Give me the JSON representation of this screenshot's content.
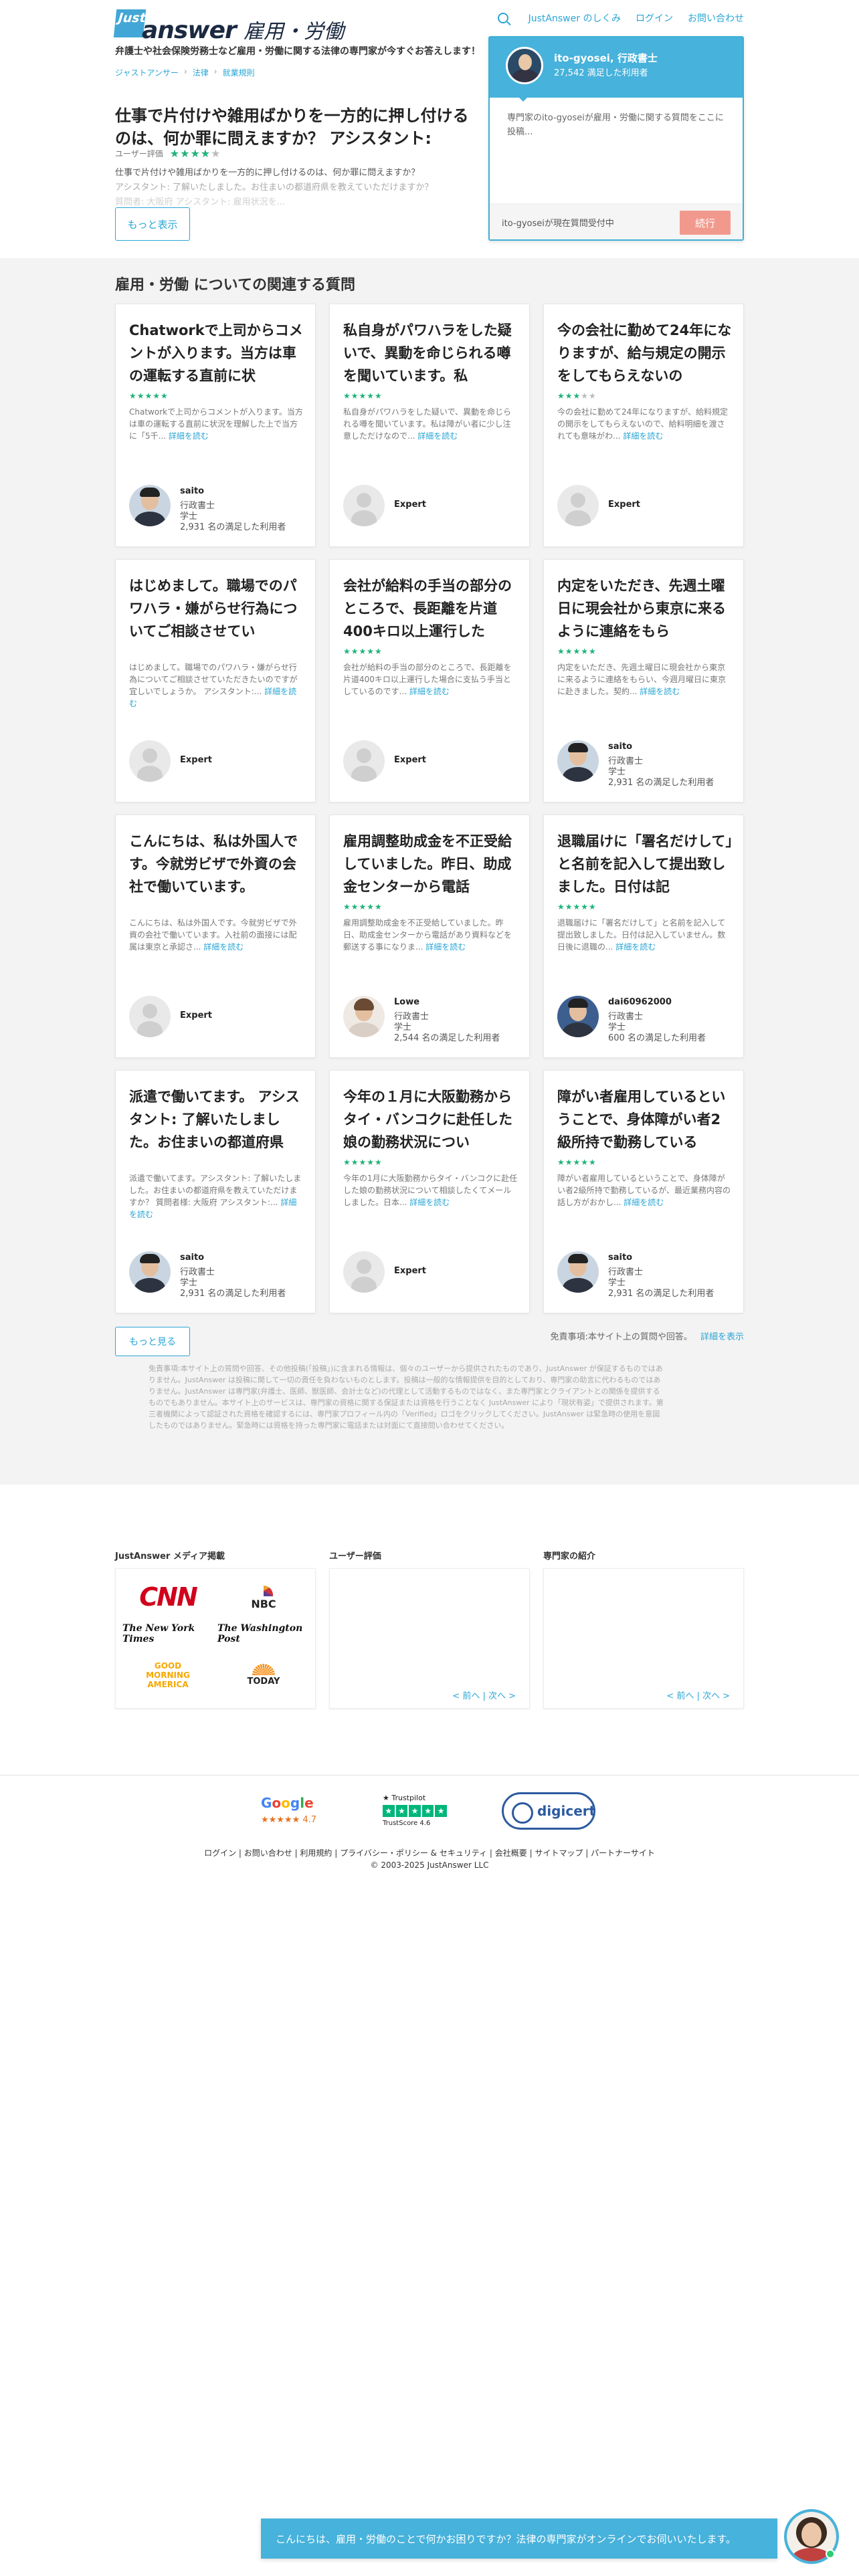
{
  "header": {
    "logo_just": "Just",
    "logo_answer": "answer",
    "logo_category": "雇用・労働",
    "tagline": "弁護士や社会保険労務士など雇用・労働に関する法律の専門家が今すぐお答えします！",
    "nav": [
      "JustAnswer のしくみ",
      "ログイン",
      "お問い合わせ"
    ]
  },
  "breadcrumb": [
    "ジャストアンサー",
    "法律",
    "就業規則"
  ],
  "question": {
    "title": "仕事で片付けや雑用ばかりを一方的に押し付けるのは、何か罪に問えますか？ アシスタント:",
    "rating_label": "ユーザー評価",
    "stars": "★★★★",
    "stars_off": "★",
    "body_line1": "仕事で片付けや雑用ばかりを一方的に押し付けるのは、何か罪に問えますか？",
    "body_line2": "アシスタント: 了解いたしました。お住まいの都道府県を教えていただけますか？",
    "body_line3": "質問者: 大阪府 アシスタント: 雇用状況を...",
    "more_button": "もっと表示"
  },
  "chat_widget": {
    "expert_name": "ito-gyosei, 行政書士",
    "expert_sub": "27,542 満足した利用者",
    "message": "専門家のito-gyoseiが雇用・労働に関する質問をここに投稿...",
    "status": "ito-gyoseiが現在質問受付中",
    "button": "続行"
  },
  "related": {
    "title": "雇用・労働 についての関連する質問",
    "read_more": "詳細を読む",
    "cards": [
      {
        "title": "Chatworkで上司からコメントが入ります。当方は車の運転する直前に状",
        "stars": "★★★★★",
        "stars_off": "",
        "snippet": "Chatworkで上司からコメントが入ります。当方は車の運転する直前に状況を理解した上で当方に「5千...",
        "expert": {
          "name": "saito",
          "line1": "行政書士",
          "line2": "学士",
          "line3": "2,931 名の満足した利用者"
        },
        "avatar": "photo"
      },
      {
        "title": "私自身がパワハラをした疑いで、異動を命じられる噂を聞いています。私",
        "stars": "★★★★★",
        "stars_off": "",
        "snippet": "私自身がパワハラをした疑いで、異動を命じられる噂を聞いています。私は障がい者に少し注意しただけなので...",
        "expert": {
          "name": "Expert"
        },
        "avatar": "generic"
      },
      {
        "title": "今の会社に勤めて24年になりますが、給与規定の開示をしてもらえないの",
        "stars": "★★★",
        "stars_off": "★★",
        "snippet": "今の会社に勤めて24年になりますが、給料規定の開示をしてもらえないので、給料明細を渡されても意味がわ...",
        "expert": {
          "name": "Expert"
        },
        "avatar": "generic"
      },
      {
        "title": "はじめまして。職場でのパワハラ・嫌がらせ行為についてご相談させてい",
        "stars": "",
        "stars_off": "",
        "snippet": "はじめまして。職場でのパワハラ・嫌がらせ行為についてご相談させていただきたいのですが宜しいでしょうか。 アシスタント:...",
        "expert": {
          "name": "Expert"
        },
        "avatar": "generic"
      },
      {
        "title": "会社が給料の手当の部分のところで、長距離を片道400キロ以上運行した",
        "stars": "★★★★★",
        "stars_off": "",
        "snippet": "会社が給料の手当の部分のところで、長距離を片道400キロ以上運行した場合に支払う手当としているのです...",
        "expert": {
          "name": "Expert"
        },
        "avatar": "generic"
      },
      {
        "title": "内定をいただき、先週土曜日に現会社から東京に来るように連絡をもら",
        "stars": "★★★★★",
        "stars_off": "",
        "snippet": "内定をいただき、先週土曜日に現会社から東京に来るように連絡をもらい、今週月曜日に東京に赴きました。契約...",
        "expert": {
          "name": "saito",
          "line1": "行政書士",
          "line2": "学士",
          "line3": "2,931 名の満足した利用者"
        },
        "avatar": "photo"
      },
      {
        "title": "こんにちは、私は外国人です。今就労ビザで外資の会社で働いています。",
        "stars": "",
        "stars_off": "",
        "snippet": "こんにちは、私は外国人です。今就労ビザで外資の会社で働いています。入社前の面接には配属は東京と承認さ...",
        "expert": {
          "name": "Expert"
        },
        "avatar": "generic"
      },
      {
        "title": "雇用調整助成金を不正受給していました。昨日、助成金センターから電話",
        "stars": "★★★★★",
        "stars_off": "",
        "snippet": "雇用調整助成金を不正受給していました。昨日、助成金センターから電話があり資料などを郵送する事になりま...",
        "expert": {
          "name": "Lowe",
          "line1": "行政書士",
          "line2": "学士",
          "line3": "2,544 名の満足した利用者"
        },
        "avatar": "photo-f"
      },
      {
        "title": "退職届けに「署名だけして」と名前を記入して提出致しました。日付は記",
        "stars": "★★★★★",
        "stars_off": "",
        "snippet": "退職届けに「署名だけして」と名前を記入して提出致しました。日付は記入していません。数日後に退職の...",
        "expert": {
          "name": "dai60962000",
          "line1": "行政書士",
          "line2": "学士",
          "line3": "600 名の満足した利用者"
        },
        "avatar": "photo-b"
      },
      {
        "title": "派遣で働いてます。 アシスタント: 了解いたしました。お住まいの都道府県",
        "stars": "",
        "stars_off": "",
        "snippet": "派遣で働いてます。アシスタント: 了解いたしました。お住まいの都道府県を教えていただけますか？ 質問者様: 大阪府 アシスタント:...",
        "expert": {
          "name": "saito",
          "line1": "行政書士",
          "line2": "学士",
          "line3": "2,931 名の満足した利用者"
        },
        "avatar": "photo"
      },
      {
        "title": "今年の１月に大阪勤務からタイ・バンコクに赴任した娘の勤務状況につい",
        "stars": "★★★★★",
        "stars_off": "",
        "snippet": "今年の1月に大阪勤務からタイ・バンコクに赴任した娘の勤務状況について相談したくてメールしました。日本...",
        "expert": {
          "name": "Expert"
        },
        "avatar": "generic"
      },
      {
        "title": "障がい者雇用しているということで、身体障がい者2級所持で勤務している",
        "stars": "★★★★★",
        "stars_off": "",
        "snippet": "障がい者雇用しているということで、身体障がい者2級所持で勤務しているが、最近業務内容の話し方がおかし...",
        "expert": {
          "name": "saito",
          "line1": "行政書士",
          "line2": "学士",
          "line3": "2,931 名の満足した利用者"
        },
        "avatar": "photo"
      }
    ],
    "see_more": "もっと見る",
    "disclaimer_head": "免責事項:本サイト上の質問や回答。",
    "disclaimer_link": "詳細を表示",
    "disclaimer_body": "免責事項:本サイト上の質問や回答、その他投稿(「投稿」)に含まれる情報は、個々のユーザーから提供されたものであり、JustAnswer が保証するものではありません。JustAnswer は投稿に関して一切の責任を負わないものとします。投稿は一般的な情報提供を目的としており、専門家の助言に代わるものではありません。JustAnswer は専門家(弁護士、医師、獣医師、会計士など)の代理として活動するものではなく、また専門家とクライアントとの関係を提供するものでもありません。本サイト上のサービスは、専門家の資格に関する保証または資格を行うことなく JustAnswer により「現状有姿」で提供されます。第三者機関によって認証された資格を確認するには、専門家プロフィール内の「Verified」ロゴをクリックしてください。JustAnswer は緊急時の使用を意図したものではありません。緊急時には資格を持った専門家に電話または対面にて直接問い合わせてください。"
  },
  "media": {
    "title": "JustAnswer メディア掲載",
    "cnn": "CNN",
    "nbc": "NBC",
    "nyt": "The New York Times",
    "wp": "The Washington Post",
    "gma": "GOOD MORNING AMERICA",
    "today": "TODAY"
  },
  "reviews": {
    "title": "ユーザー評価",
    "pager": "< 前へ | 次へ >"
  },
  "experts_intro": {
    "title": "専門家の紹介",
    "pager": "< 前へ | 次へ >"
  },
  "footer": {
    "google": [
      "G",
      "o",
      "o",
      "g",
      "l",
      "e"
    ],
    "google_rating": "★★★★★ 4.7",
    "trustpilot": "★ Trustpilot",
    "trustpilot_score": "TrustScore 4.6",
    "digicert": "digicert",
    "links": "ログイン | お問い合わせ | 利用規約 | プライバシー・ポリシー & セキュリティ | 会社概要 | サイトマップ | パートナーサイト",
    "copyright": "© 2003-2025 JustAnswer LLC"
  },
  "chatbar": {
    "message": "こんにちは、雇用・労働のことで何かお困りですか？法律の専門家がオンラインでお伺いいたします。"
  }
}
